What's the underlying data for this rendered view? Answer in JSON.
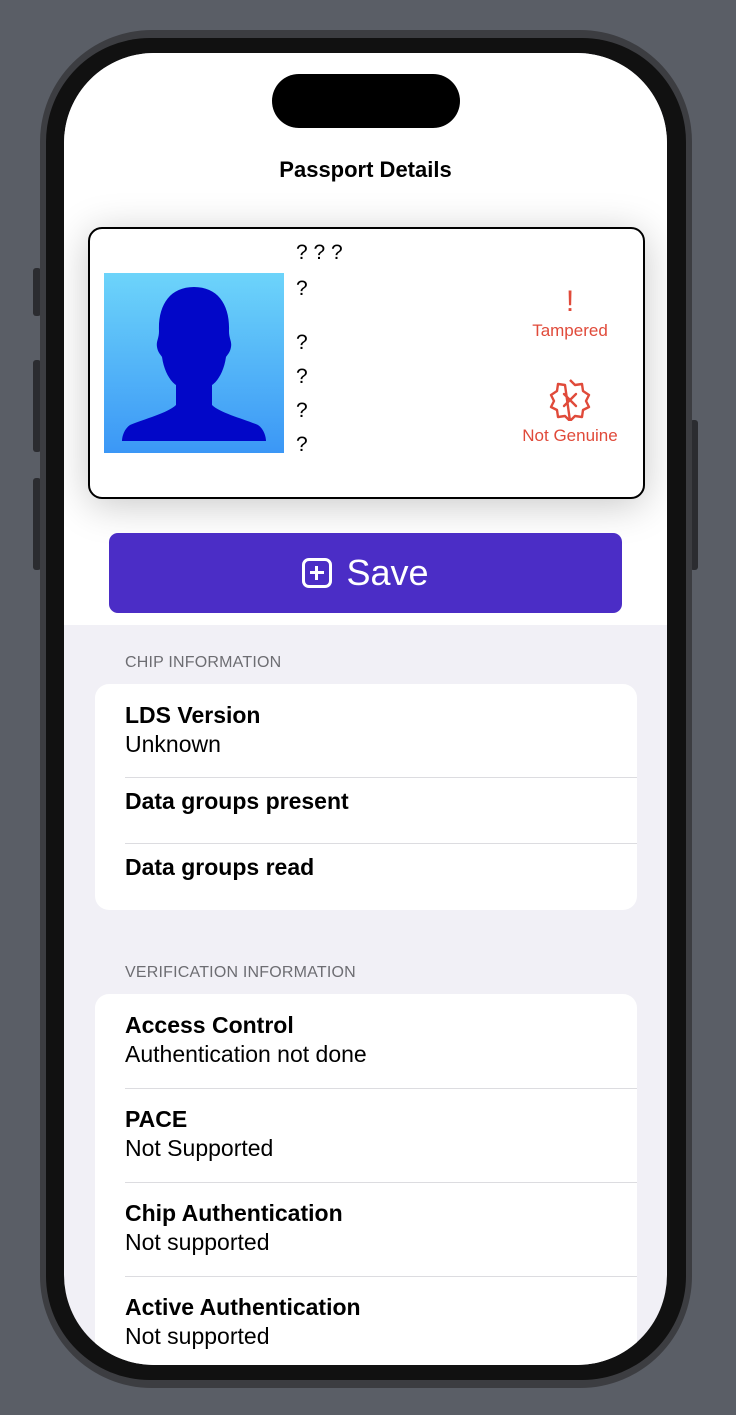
{
  "nav": {
    "title": "Passport Details"
  },
  "card": {
    "field_lines": [
      "? ? ?",
      "?",
      "?",
      "?",
      "?",
      "?"
    ],
    "statuses": [
      {
        "label": "Tampered",
        "icon": "exclamation-icon"
      },
      {
        "label": "Not Genuine",
        "icon": "xmark-seal-icon"
      }
    ],
    "status_color": "#e04a3a",
    "photo_placeholder_icon": "person-silhouette-icon"
  },
  "save_button": {
    "label": "Save",
    "icon": "plus-square-icon",
    "color": "#4b2dc6"
  },
  "chip_section": {
    "header": "CHIP INFORMATION",
    "rows": [
      {
        "title": "LDS Version",
        "value": "Unknown"
      },
      {
        "title": "Data groups present",
        "value": ""
      },
      {
        "title": "Data groups read",
        "value": ""
      }
    ]
  },
  "verification_section": {
    "header": "VERIFICATION INFORMATION",
    "rows": [
      {
        "title": "Access Control",
        "value": "Authentication not done"
      },
      {
        "title": "PACE",
        "value": "Not Supported"
      },
      {
        "title": "Chip Authentication",
        "value": "Not supported"
      },
      {
        "title": "Active Authentication",
        "value": "Not supported"
      }
    ]
  }
}
